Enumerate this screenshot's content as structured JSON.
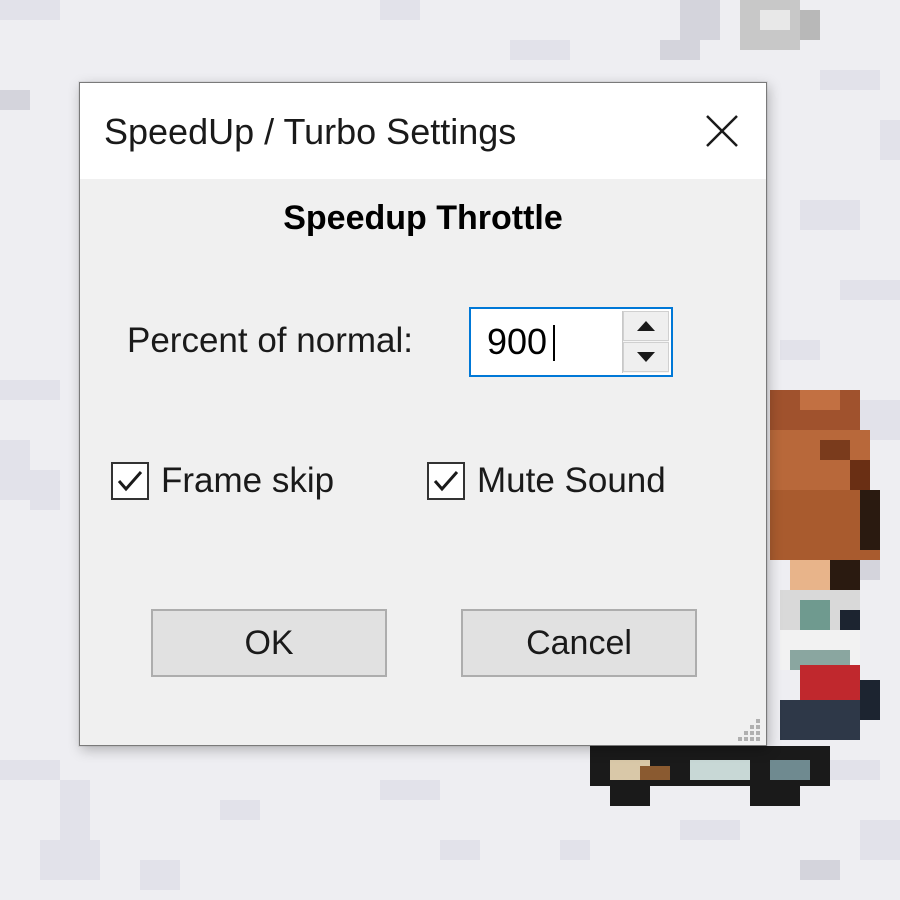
{
  "dialog": {
    "title": "SpeedUp / Turbo Settings",
    "close_icon": "close-icon",
    "heading": "Speedup Throttle",
    "percent": {
      "label": "Percent of normal:",
      "value": "900",
      "spin_up_icon": "triangle-up-icon",
      "spin_down_icon": "triangle-down-icon"
    },
    "options": {
      "frame_skip": {
        "label": "Frame skip",
        "checked": true
      },
      "mute_sound": {
        "label": "Mute Sound",
        "checked": true
      }
    },
    "buttons": {
      "ok": "OK",
      "cancel": "Cancel"
    },
    "resize_grip_icon": "resize-grip-icon"
  },
  "colors": {
    "focus_border": "#0078d7",
    "dialog_bg": "#f0f0f0",
    "titlebar_bg": "#ffffff",
    "button_bg": "#e1e1e1",
    "button_border": "#adadad"
  }
}
